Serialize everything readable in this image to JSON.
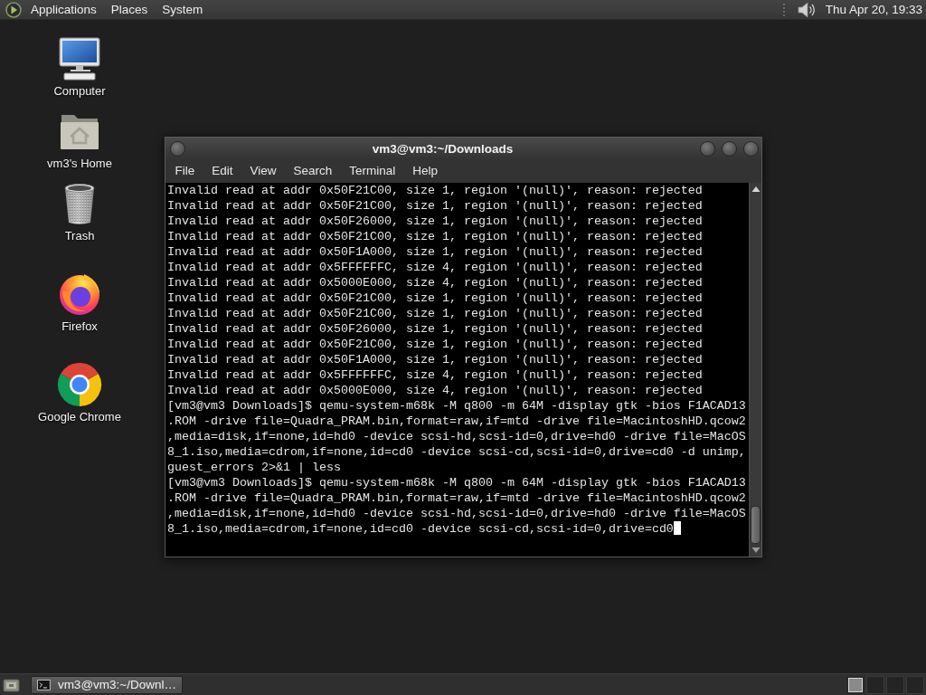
{
  "top_panel": {
    "menus": [
      "Applications",
      "Places",
      "System"
    ],
    "clock": "Thu Apr 20, 19:33"
  },
  "desktop_icons": [
    {
      "kind": "computer",
      "label": "Computer"
    },
    {
      "kind": "home",
      "label": "vm3's Home"
    },
    {
      "kind": "trash",
      "label": "Trash"
    },
    {
      "kind": "firefox",
      "label": "Firefox"
    },
    {
      "kind": "chrome",
      "label": "Google Chrome"
    }
  ],
  "terminal": {
    "title": "vm3@vm3:~/Downloads",
    "menu": [
      "File",
      "Edit",
      "View",
      "Search",
      "Terminal",
      "Help"
    ],
    "lines": [
      {
        "kind": "output",
        "text": "Invalid read at addr 0x50F21C00, size 1, region '(null)', reason: rejected"
      },
      {
        "kind": "output",
        "text": "Invalid read at addr 0x50F21C00, size 1, region '(null)', reason: rejected"
      },
      {
        "kind": "output",
        "text": "Invalid read at addr 0x50F26000, size 1, region '(null)', reason: rejected"
      },
      {
        "kind": "output",
        "text": "Invalid read at addr 0x50F21C00, size 1, region '(null)', reason: rejected"
      },
      {
        "kind": "output",
        "text": "Invalid read at addr 0x50F1A000, size 1, region '(null)', reason: rejected"
      },
      {
        "kind": "output",
        "text": "Invalid read at addr 0x5FFFFFFC, size 4, region '(null)', reason: rejected"
      },
      {
        "kind": "output",
        "text": "Invalid read at addr 0x5000E000, size 4, region '(null)', reason: rejected"
      },
      {
        "kind": "output",
        "text": "Invalid read at addr 0x50F21C00, size 1, region '(null)', reason: rejected"
      },
      {
        "kind": "output",
        "text": "Invalid read at addr 0x50F21C00, size 1, region '(null)', reason: rejected"
      },
      {
        "kind": "output",
        "text": "Invalid read at addr 0x50F26000, size 1, region '(null)', reason: rejected"
      },
      {
        "kind": "output",
        "text": "Invalid read at addr 0x50F21C00, size 1, region '(null)', reason: rejected"
      },
      {
        "kind": "output",
        "text": "Invalid read at addr 0x50F1A000, size 1, region '(null)', reason: rejected"
      },
      {
        "kind": "output",
        "text": "Invalid read at addr 0x5FFFFFFC, size 4, region '(null)', reason: rejected"
      },
      {
        "kind": "output",
        "text": "Invalid read at addr 0x5000E000, size 4, region '(null)', reason: rejected"
      },
      {
        "kind": "command",
        "cursor": false,
        "text": "[vm3@vm3 Downloads]$ qemu-system-m68k -M q800 -m 64M -display gtk -bios F1ACAD13.ROM -drive file=Quadra_PRAM.bin,format=raw,if=mtd -drive file=MacintoshHD.qcow2,media=disk,if=none,id=hd0 -device scsi-hd,scsi-id=0,drive=hd0 -drive file=MacOS8_1.iso,media=cdrom,if=none,id=cd0 -device scsi-cd,scsi-id=0,drive=cd0 -d unimp,guest_errors 2>&1 | less"
      },
      {
        "kind": "command",
        "cursor": true,
        "text": "[vm3@vm3 Downloads]$ qemu-system-m68k -M q800 -m 64M -display gtk -bios F1ACAD13.ROM -drive file=Quadra_PRAM.bin,format=raw,if=mtd -drive file=MacintoshHD.qcow2,media=disk,if=none,id=hd0 -device scsi-hd,scsi-id=0,drive=hd0 -drive file=MacOS8_1.iso,media=cdrom,if=none,id=cd0 -device scsi-cd,scsi-id=0,drive=cd0"
      }
    ]
  },
  "taskbar": {
    "tasks": [
      {
        "label": "vm3@vm3:~/Downl…",
        "selected": true
      }
    ],
    "workspaces": [
      {
        "selected": true
      },
      {
        "selected": false
      },
      {
        "selected": false
      },
      {
        "selected": false
      }
    ]
  }
}
